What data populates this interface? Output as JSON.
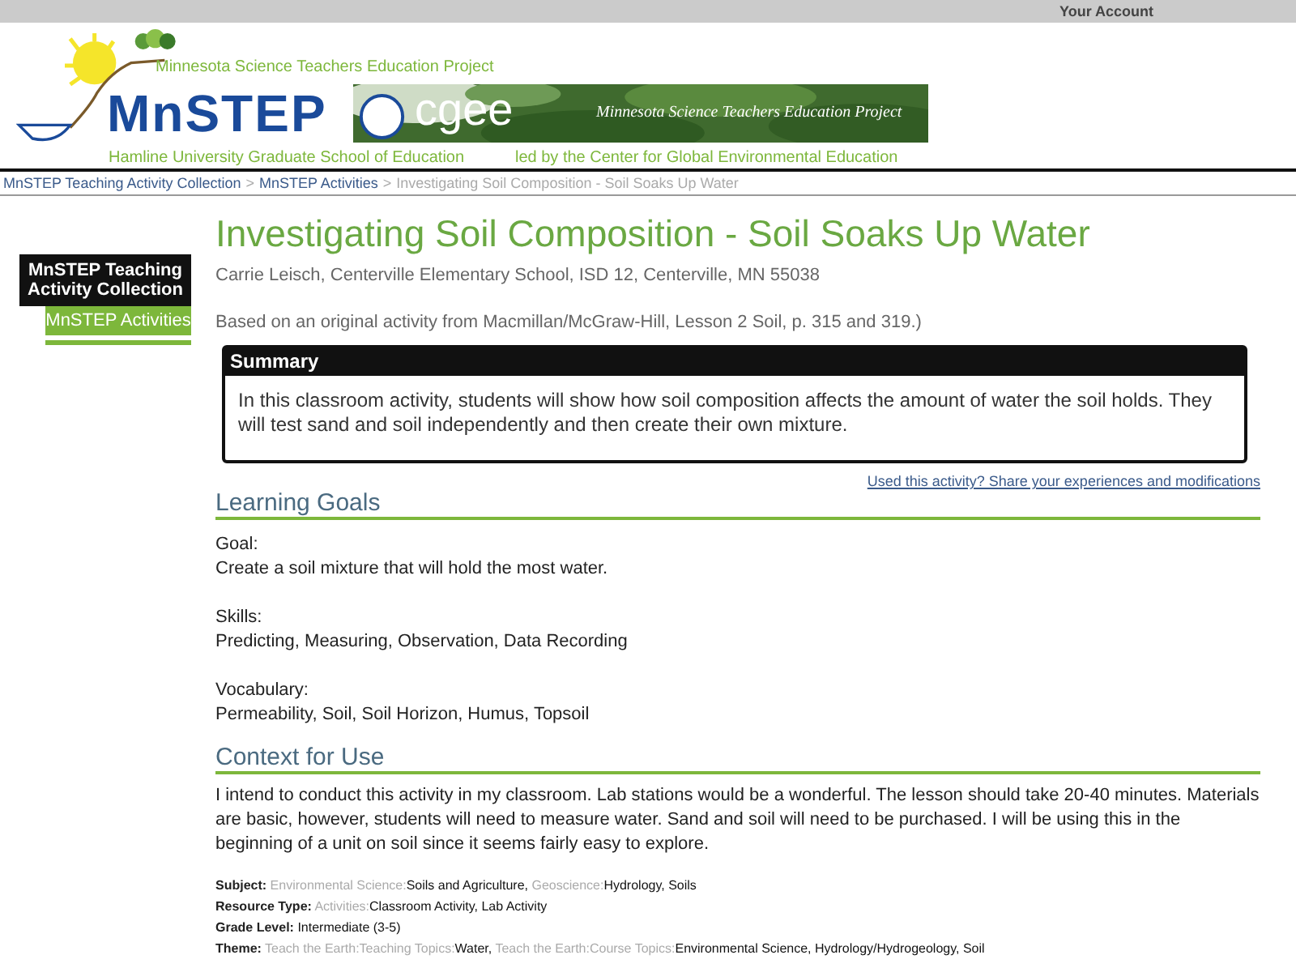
{
  "top_bar": {
    "account_link": "Your Account"
  },
  "banner": {
    "tagline": "Minnesota Science Teachers Education Project",
    "logo_text": "MnSTEP",
    "school": "Hamline University Graduate School of Education",
    "partner_logo": "cgee",
    "partner_caption": "Minnesota Science Teachers Education Project",
    "partner_credit": "led by the Center for Global Environmental Education"
  },
  "breadcrumb": [
    {
      "label": "MnSTEP Teaching Activity Collection",
      "kind": "link"
    },
    {
      "label": ">",
      "kind": "separator"
    },
    {
      "label": "MnSTEP Activities",
      "kind": "link"
    },
    {
      "label": ">",
      "kind": "separator"
    },
    {
      "label": "Investigating Soil Composition - Soil Soaks Up Water",
      "kind": "current"
    }
  ],
  "sidebar": {
    "title": "MnSTEP Teaching Activity Collection",
    "items": [
      {
        "label": "MnSTEP Activities",
        "selected": true
      }
    ]
  },
  "title": "Investigating Soil Composition - Soil Soaks Up Water",
  "author": "Carrie Leisch, Centerville Elementary School, ISD 12, Centerville, MN 55038",
  "source": "Based on an original activity from Macmillan/McGraw-Hill, Lesson 2 Soil, p. 315 and 319.)",
  "summary": {
    "heading": "Summary",
    "text": "In this classroom activity, students will show how soil composition affects the amount of water the soil holds. They will test sand and soil independently and then create their own mixture."
  },
  "share_link": "Used this activity? Share your experiences and modifications",
  "learning_goals": {
    "heading": "Learning Goals",
    "groups": [
      {
        "label": "Goal:",
        "text": "Create a soil mixture that will hold the most water."
      },
      {
        "label": "Skills:",
        "text": "Predicting, Measuring, Observation, Data Recording"
      },
      {
        "label": "Vocabulary:",
        "text": "Permeability, Soil, Soil Horizon, Humus, Topsoil"
      }
    ]
  },
  "context": {
    "heading": "Context for Use",
    "text": "I intend to conduct this activity in my classroom. Lab stations would be a wonderful. The lesson should take 20-40 minutes. Materials are basic, however, students will need to measure water. Sand and soil will need to be purchased. I will be using this in the beginning of a unit on soil since it seems fairly easy to explore."
  },
  "metadata": [
    {
      "label": "Subject:",
      "parts": [
        {
          "text": "Environmental Science:",
          "kind": "path"
        },
        {
          "text": "Soils and Agriculture,",
          "kind": "term"
        },
        {
          "text": "Geoscience:",
          "kind": "path"
        },
        {
          "text": "Hydrology, Soils",
          "kind": "term"
        }
      ]
    },
    {
      "label": "Resource Type:",
      "parts": [
        {
          "text": "Activities:",
          "kind": "path"
        },
        {
          "text": "Classroom Activity, Lab Activity",
          "kind": "term"
        }
      ]
    },
    {
      "label": "Grade Level:",
      "parts": [
        {
          "text": "Intermediate (3-5)",
          "kind": "term"
        }
      ]
    },
    {
      "label": "Theme:",
      "parts": [
        {
          "text": "Teach the Earth:Teaching Topics:",
          "kind": "path"
        },
        {
          "text": "Water,",
          "kind": "term"
        },
        {
          "text": "Teach the Earth:Course Topics:",
          "kind": "path"
        },
        {
          "text": "Environmental Science, Hydrology/Hydrogeology, Soil",
          "kind": "term"
        }
      ]
    }
  ]
}
